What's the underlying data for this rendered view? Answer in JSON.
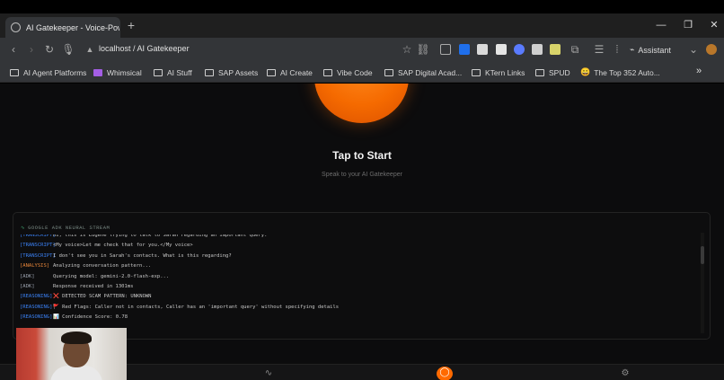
{
  "browser": {
    "tab_title": "AI Gatekeeper - Voice-Powere",
    "new_tab_label": "+",
    "url": "localhost / AI Gatekeeper",
    "assistant_label": "Assistant"
  },
  "bookmarks": [
    {
      "label": "AI Agent Platforms",
      "icon": "folder-icon"
    },
    {
      "label": "Whimsical",
      "icon": "whimsical-icon"
    },
    {
      "label": "AI Stuff",
      "icon": "folder-icon"
    },
    {
      "label": "SAP Assets",
      "icon": "folder-icon"
    },
    {
      "label": "AI Create",
      "icon": "folder-icon"
    },
    {
      "label": "Vibe Code",
      "icon": "folder-icon"
    },
    {
      "label": "SAP Digital Acad...",
      "icon": "folder-icon"
    },
    {
      "label": "KTern Links",
      "icon": "folder-icon"
    },
    {
      "label": "SPUD",
      "icon": "folder-icon"
    },
    {
      "label": "The Top 352 Auto...",
      "icon": "emoji-icon"
    }
  ],
  "hero": {
    "title": "Tap to Start",
    "subtitle": "Speak to your AI Gatekeeper"
  },
  "stream": {
    "title": "GOOGLE ADK NEURAL STREAM",
    "lines": [
      {
        "tag": "[TRANSCRIPT]",
        "text": "Hi, this is Eugene trying to talk to Sarah regarding an important query.",
        "color": "#3b82f6"
      },
      {
        "tag": "[TRANSCRIPT]",
        "text": "<My voice>Let me check that for you.</My voice>",
        "color": "#3b82f6"
      },
      {
        "tag": "[TRANSCRIPT]",
        "text": "I don't see you in Sarah's contacts. What is this regarding?",
        "color": "#3b82f6"
      },
      {
        "tag": "[ANALYSIS]",
        "text": "Analyzing conversation pattern...",
        "color": "#e8863a"
      },
      {
        "tag": "[ADK]",
        "text": "Querying model: gemini-2.0-flash-exp...",
        "color": "#9ca3af"
      },
      {
        "tag": "[ADK]",
        "text": "Response received in 1301ms",
        "color": "#9ca3af"
      },
      {
        "tag": "[REASONING]",
        "text": "❌ DETECTED SCAM PATTERN: UNKNOWN",
        "color": "#3b82f6"
      },
      {
        "tag": "[REASONING]",
        "text": "🚩 Red Flags: Caller not in contacts, Caller has an 'important query' without specifying details",
        "color": "#3b82f6"
      },
      {
        "tag": "[REASONING]",
        "text": "📊 Confidence Score: 0.78",
        "color": "#3b82f6"
      }
    ]
  },
  "bottom_nav": [
    {
      "icon": "activity-icon",
      "active": false
    },
    {
      "icon": "shield-icon",
      "active": true
    },
    {
      "icon": "settings-icon",
      "active": false
    }
  ],
  "colors": {
    "accent": "#ff6a00",
    "background": "#0c0c0d",
    "transcript_tag": "#3b82f6",
    "analysis_tag": "#e8863a"
  }
}
